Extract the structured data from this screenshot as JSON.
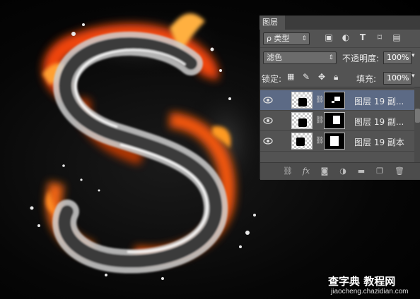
{
  "panel": {
    "tab_label": "图层",
    "filter": {
      "type_label": "ρ 类型",
      "icons": [
        "image-filter-icon",
        "adjustment-filter-icon",
        "type-filter-icon",
        "shape-filter-icon",
        "smart-object-filter-icon"
      ]
    },
    "blend_mode": "滤色",
    "opacity_label": "不透明度:",
    "opacity_value": "100%",
    "lock_label": "锁定:",
    "fill_label": "填充:",
    "fill_value": "100%",
    "layers": [
      {
        "name": "图层 19 副...",
        "selected": true,
        "visible": true
      },
      {
        "name": "图层 19 副...",
        "selected": false,
        "visible": true
      },
      {
        "name": "图层 19 副本",
        "selected": false,
        "visible": true
      }
    ],
    "bottom_icons": [
      "link-icon",
      "fx-icon",
      "mask-icon",
      "adjustment-icon",
      "folder-icon",
      "new-layer-icon",
      "trash-icon"
    ],
    "fx_label": "fx"
  },
  "watermark": {
    "title": "查字典 教程网",
    "url": "jiaocheng.chazidian.com"
  },
  "colors": {
    "panel_bg": "#535353",
    "selected_layer": "#5c6a85",
    "fire": "#ff5a10",
    "background": "#050505"
  }
}
